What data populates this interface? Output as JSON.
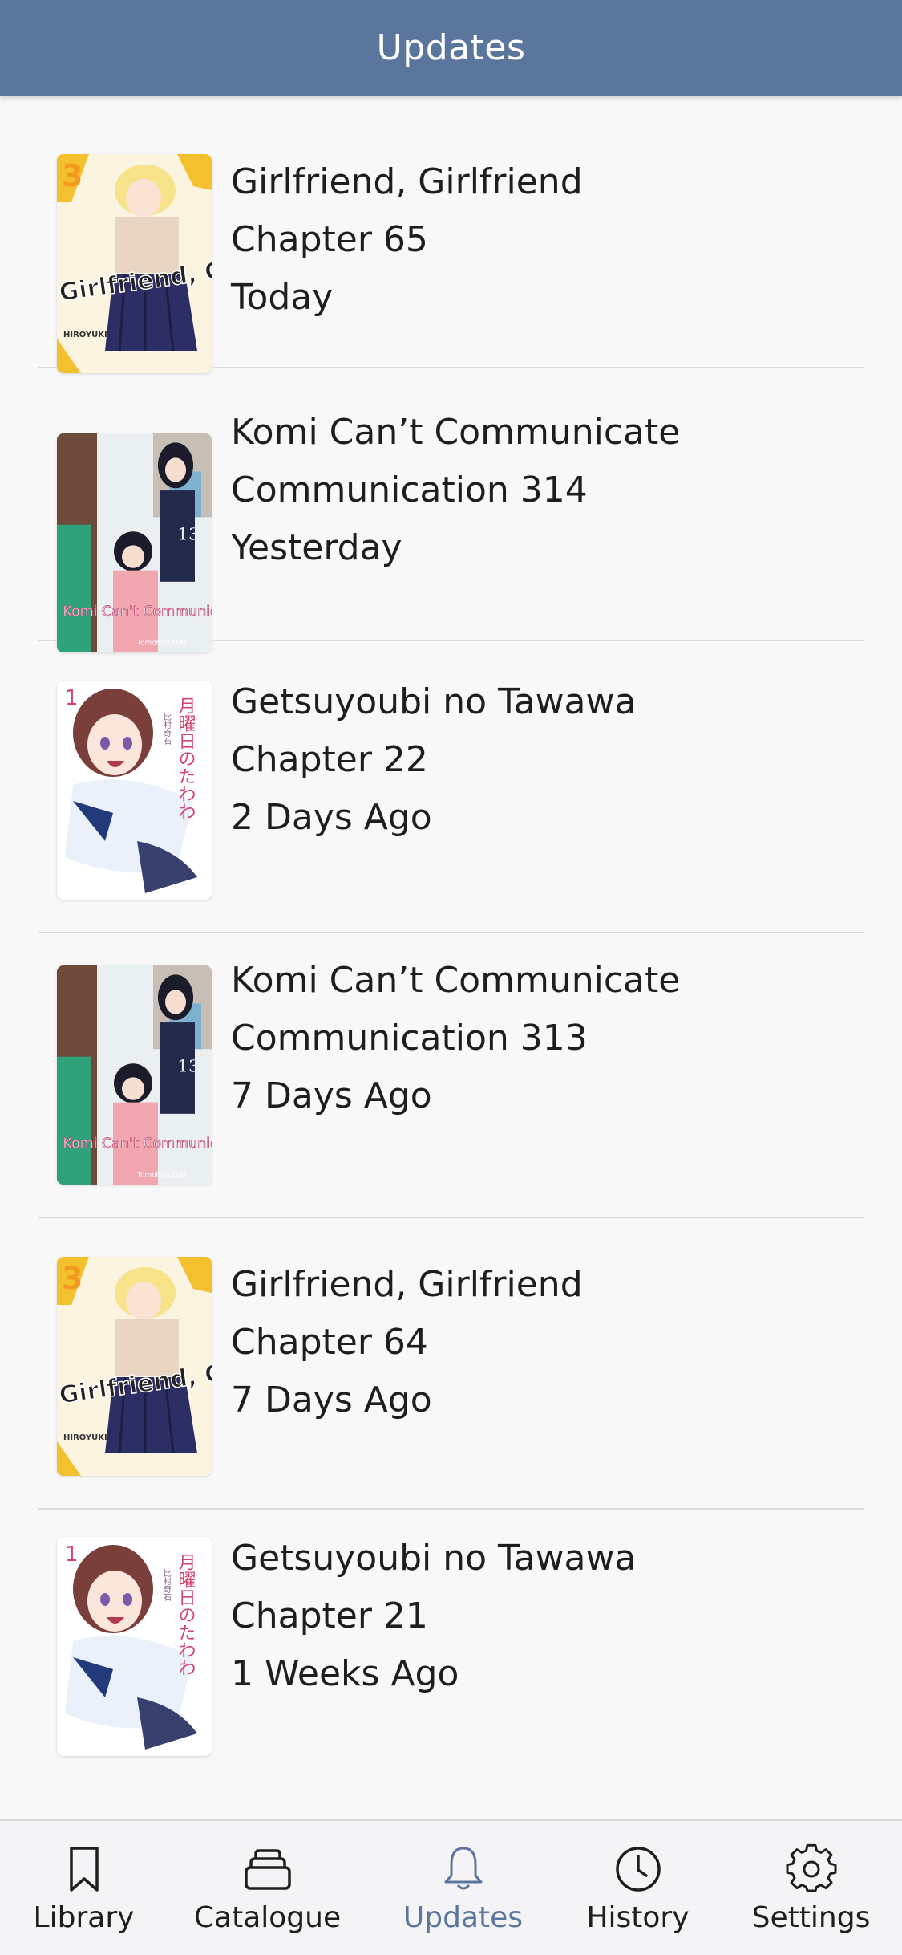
{
  "header": {
    "title": "Updates"
  },
  "updates": [
    {
      "title": "Girlfriend, Girlfriend",
      "chapter": "Chapter 65",
      "time": "Today",
      "cover": "girlfriend-cover"
    },
    {
      "title": "Komi Can’t Communicate",
      "chapter": "Communication 314",
      "time": "Yesterday",
      "cover": "komi-cover"
    },
    {
      "title": "Getsuyoubi no Tawawa",
      "chapter": "Chapter 22",
      "time": "2 Days Ago",
      "cover": "tawawa-cover"
    },
    {
      "title": "Komi Can’t Communicate",
      "chapter": "Communication 313",
      "time": "7 Days Ago",
      "cover": "komi-cover"
    },
    {
      "title": "Girlfriend, Girlfriend",
      "chapter": "Chapter 64",
      "time": "7 Days Ago",
      "cover": "girlfriend-cover"
    },
    {
      "title": "Getsuyoubi no Tawawa",
      "chapter": "Chapter 21",
      "time": "1 Weeks Ago",
      "cover": "tawawa-cover"
    }
  ],
  "covers": {
    "girlfriend": {
      "volume": "3",
      "art_title": "Girlfriend, Girlfriend",
      "author": "HIROYUKI"
    },
    "komi": {
      "volume": "13",
      "art_title": "Komi Can't Communicate",
      "author": "Tomohito Oda"
    },
    "tawawa": {
      "volume": "1",
      "art_title": "月曜日のたわわ",
      "author": "比村奇石"
    }
  },
  "tabbar": {
    "active": "Updates",
    "tabs": [
      {
        "label": "Library",
        "icon": "bookmark-icon"
      },
      {
        "label": "Catalogue",
        "icon": "stack-icon"
      },
      {
        "label": "Updates",
        "icon": "bell-icon"
      },
      {
        "label": "History",
        "icon": "clock-icon"
      },
      {
        "label": "Settings",
        "icon": "gear-icon"
      }
    ]
  },
  "colors": {
    "header_bg": "#5b769d",
    "active_tab": "#5b769d",
    "background": "#f8f8f9"
  }
}
